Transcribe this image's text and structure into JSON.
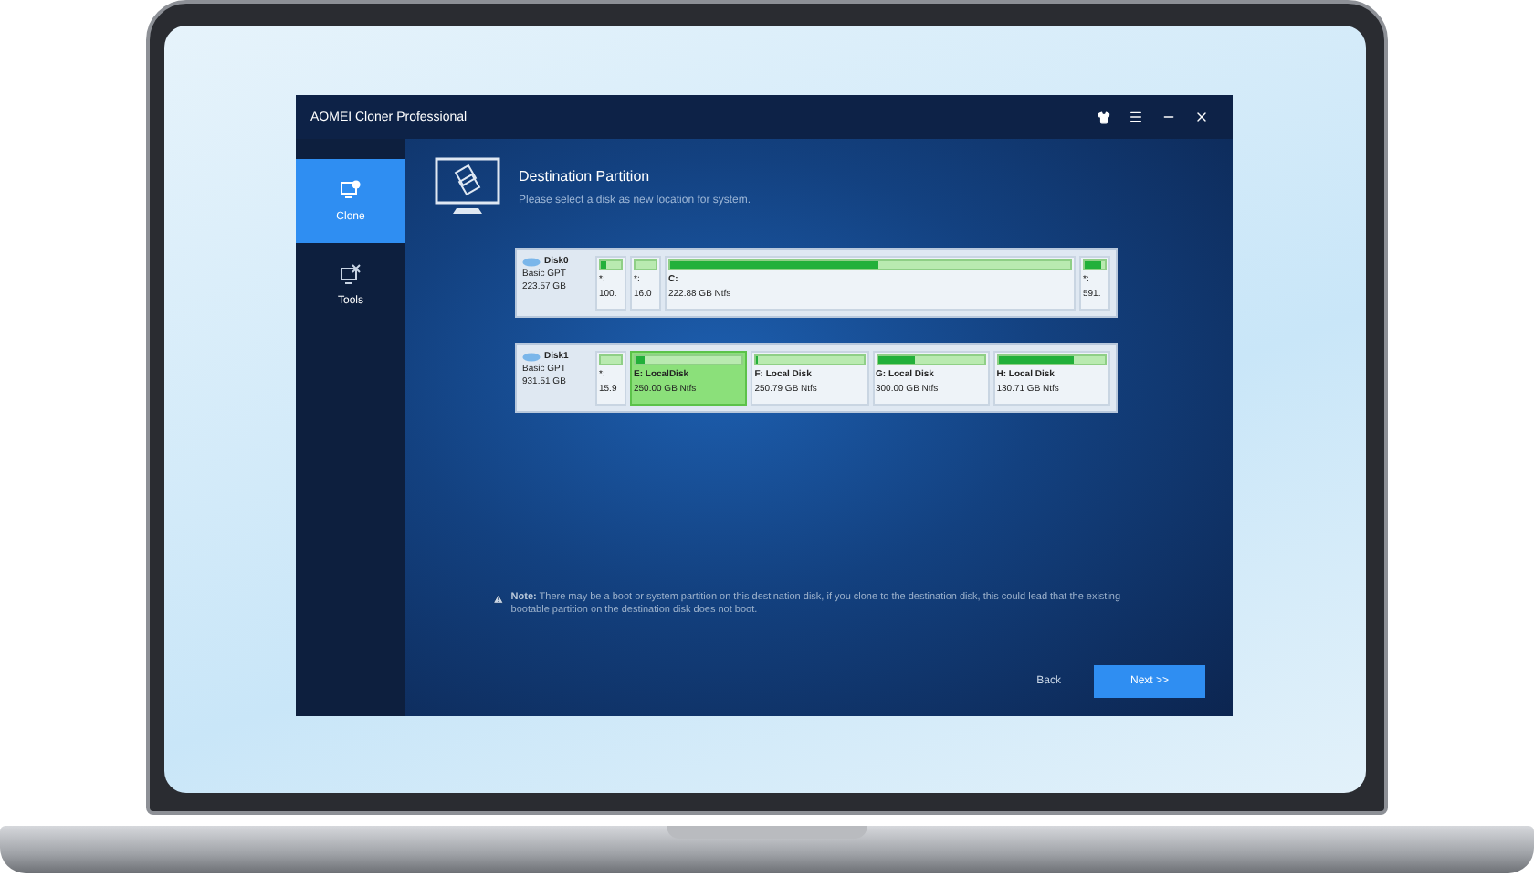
{
  "window": {
    "title": "AOMEI Cloner Professional"
  },
  "sidebar": [
    {
      "kind": "clone",
      "label": "Clone",
      "selected": true
    },
    {
      "kind": "tools",
      "label": "Tools",
      "selected": false
    }
  ],
  "header": {
    "title": "Destination Partition",
    "subtitle": "Please select a disk as new location for system."
  },
  "disks": [
    {
      "name": "Disk0",
      "type": "Basic GPT",
      "size": "223.57 GB",
      "partitions": [
        {
          "kind": "narrow",
          "label": "*:",
          "size": "100.",
          "level": 0.3,
          "selected": false
        },
        {
          "kind": "narrow",
          "label": "*:",
          "size": "16.0",
          "selected": false
        },
        {
          "kind": "wide",
          "label": "C:",
          "size": "222.88 GB Ntfs",
          "level": 0.52,
          "selected": false
        },
        {
          "kind": "narrow",
          "label": "*:",
          "size": "591.",
          "level": 0.8,
          "selected": false
        }
      ]
    },
    {
      "name": "Disk1",
      "type": "Basic GPT",
      "size": "931.51 GB",
      "partitions": [
        {
          "kind": "narrow",
          "label": "*:",
          "size": "15.9",
          "selected": false
        },
        {
          "kind": "wide",
          "label": "E: LocalDisk",
          "size": "250.00 GB Ntfs",
          "level": 0.08,
          "selected": true
        },
        {
          "kind": "wide",
          "label": "F: Local Disk",
          "size": "250.79 GB Ntfs",
          "level": 0.02,
          "selected": false
        },
        {
          "kind": "wide",
          "label": "G: Local Disk",
          "size": "300.00 GB Ntfs",
          "level": 0.35,
          "selected": false
        },
        {
          "kind": "wide",
          "label": "H: Local Disk",
          "size": "130.71 GB Ntfs",
          "level": 0.7,
          "selected": false
        }
      ]
    }
  ],
  "note": "**Note:** There may be a boot or system partition on this destination disk, if you clone to the destination disk, this could lead that the existing bootable partition on the destination disk does not boot.",
  "buttons": {
    "back": "Back",
    "next": "Next >>"
  }
}
